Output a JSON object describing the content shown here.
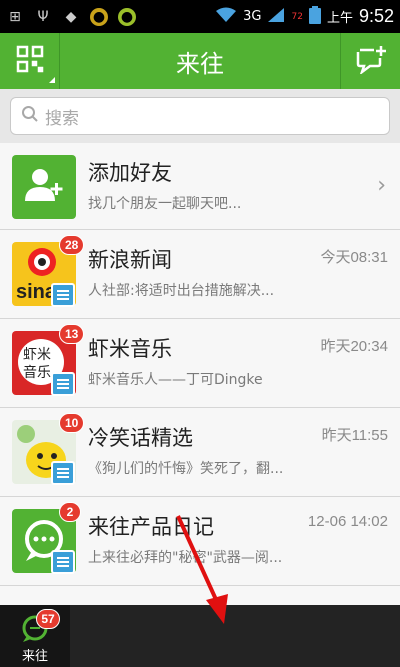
{
  "status_bar": {
    "network": "3G",
    "signal_extra": "72",
    "time_prefix": "上午",
    "time": "9:52"
  },
  "header": {
    "title": "来往"
  },
  "search": {
    "placeholder": "搜索"
  },
  "conversations": [
    {
      "title": "添加好友",
      "subtitle": "找几个朋友一起聊天吧...",
      "time": "",
      "badge": ""
    },
    {
      "title": "新浪新闻",
      "subtitle": "人社部:将适时出台措施解决...",
      "time": "今天08:31",
      "badge": "28"
    },
    {
      "title": "虾米音乐",
      "subtitle": "虾米音乐人——丁可Dingke",
      "time": "昨天20:34",
      "badge": "13"
    },
    {
      "title": "冷笑话精选",
      "subtitle": "《狗儿们的忏悔》笑死了，翻...",
      "time": "昨天11:55",
      "badge": "10"
    },
    {
      "title": "来往产品日记",
      "subtitle": "上来往必拜的\"秘密\"武器—阅...",
      "time": "12-06 14:02",
      "badge": "2"
    }
  ],
  "bottom_tab": {
    "label": "来往",
    "badge": "57"
  },
  "colors": {
    "primary": "#52b233",
    "badge": "#e53a2e"
  }
}
